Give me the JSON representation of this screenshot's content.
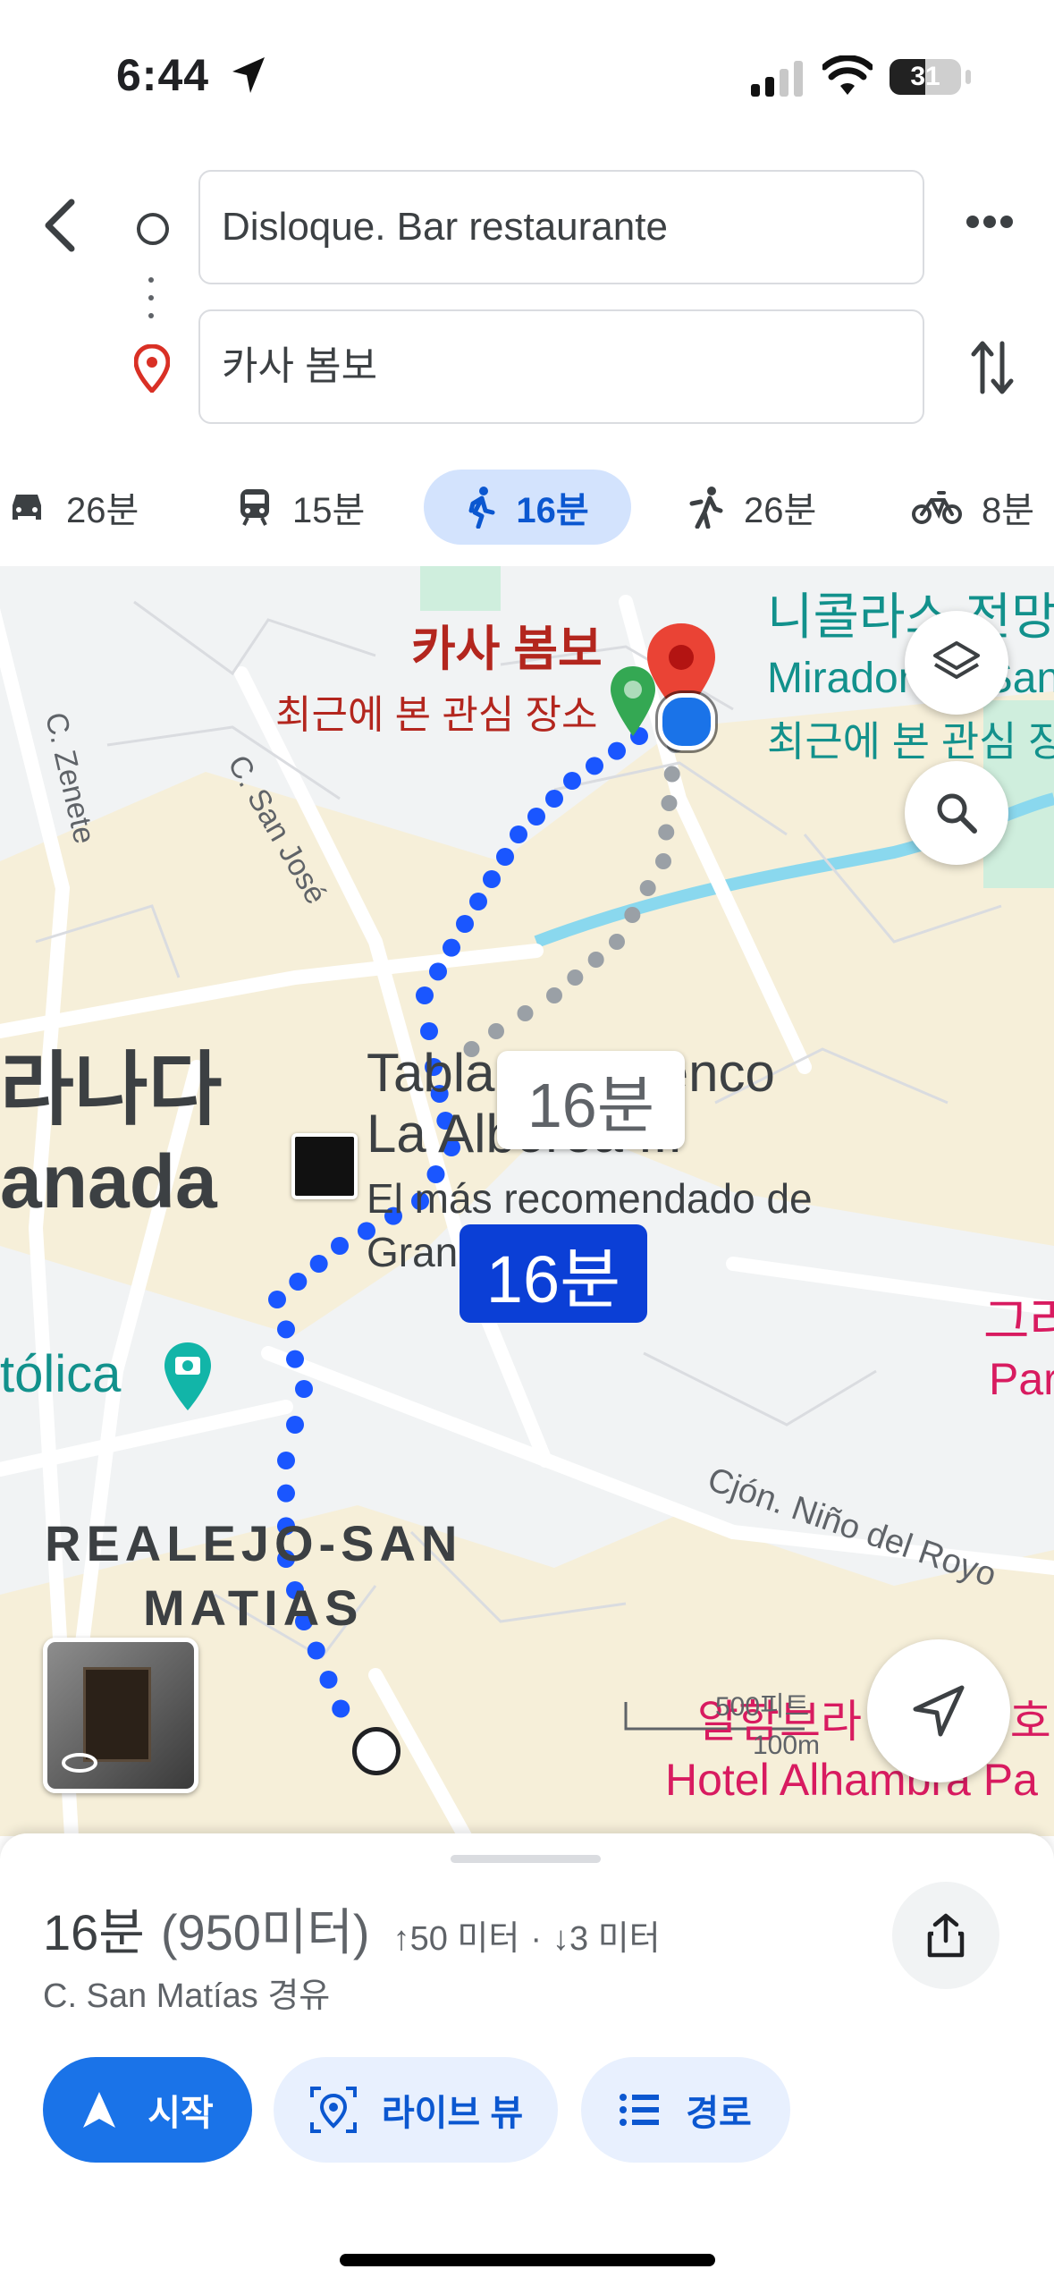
{
  "status": {
    "time": "6:44",
    "battery": "31"
  },
  "route": {
    "origin": "Disloque. Bar restaurante",
    "destination": "카사 봄보"
  },
  "modes": [
    {
      "name": "drive",
      "label": "26분"
    },
    {
      "name": "transit",
      "label": "15분"
    },
    {
      "name": "walk",
      "label": "16분",
      "selected": true
    },
    {
      "name": "rideshare",
      "label": "26분"
    },
    {
      "name": "cycle",
      "label": "8분"
    }
  ],
  "map": {
    "streets": [
      "C. Zenete",
      "C. San José",
      "Cjón. Niño del Royo"
    ],
    "place_dest": {
      "name": "카사 봄보",
      "sub": "최근에 본 관심 장소"
    },
    "place_nicolas": {
      "name": "니콜라스 전망",
      "name2": "Mirador de San",
      "sub": "최근에 본 관심 장소"
    },
    "place_tablao": {
      "name1": "Tablao Flamenco",
      "name2": "La Alborea ...",
      "sub1": "El más recomendado de",
      "sub2": "Gran"
    },
    "city_kr": "라나다",
    "city": "anada",
    "catolica": "tólica",
    "district1": "REALEJO-SAN",
    "district2": "MATIAS",
    "alhambra_kr": "알함브라 팰리스 호",
    "alhambra": "Hotel Alhambra Pa",
    "gra_kr": "그라",
    "par": "Par",
    "scale": "100m",
    "scale_ft": "500피트",
    "alt_time": "16분",
    "main_time": "16분"
  },
  "sheet": {
    "duration": "16분",
    "distance": "(950미터)",
    "up": "50 미터",
    "down": "3 미터",
    "sep": "·",
    "via": "C. San Matías 경유",
    "start": "시작",
    "live": "라이브 뷰",
    "steps": "경로"
  },
  "colors": {
    "route_blue": "#1a56ff",
    "label_blue": "#0b3fd6",
    "accent": "#1a73e8",
    "poi_red": "#b3261e",
    "teal": "#12918c",
    "pink": "#d81b60"
  }
}
